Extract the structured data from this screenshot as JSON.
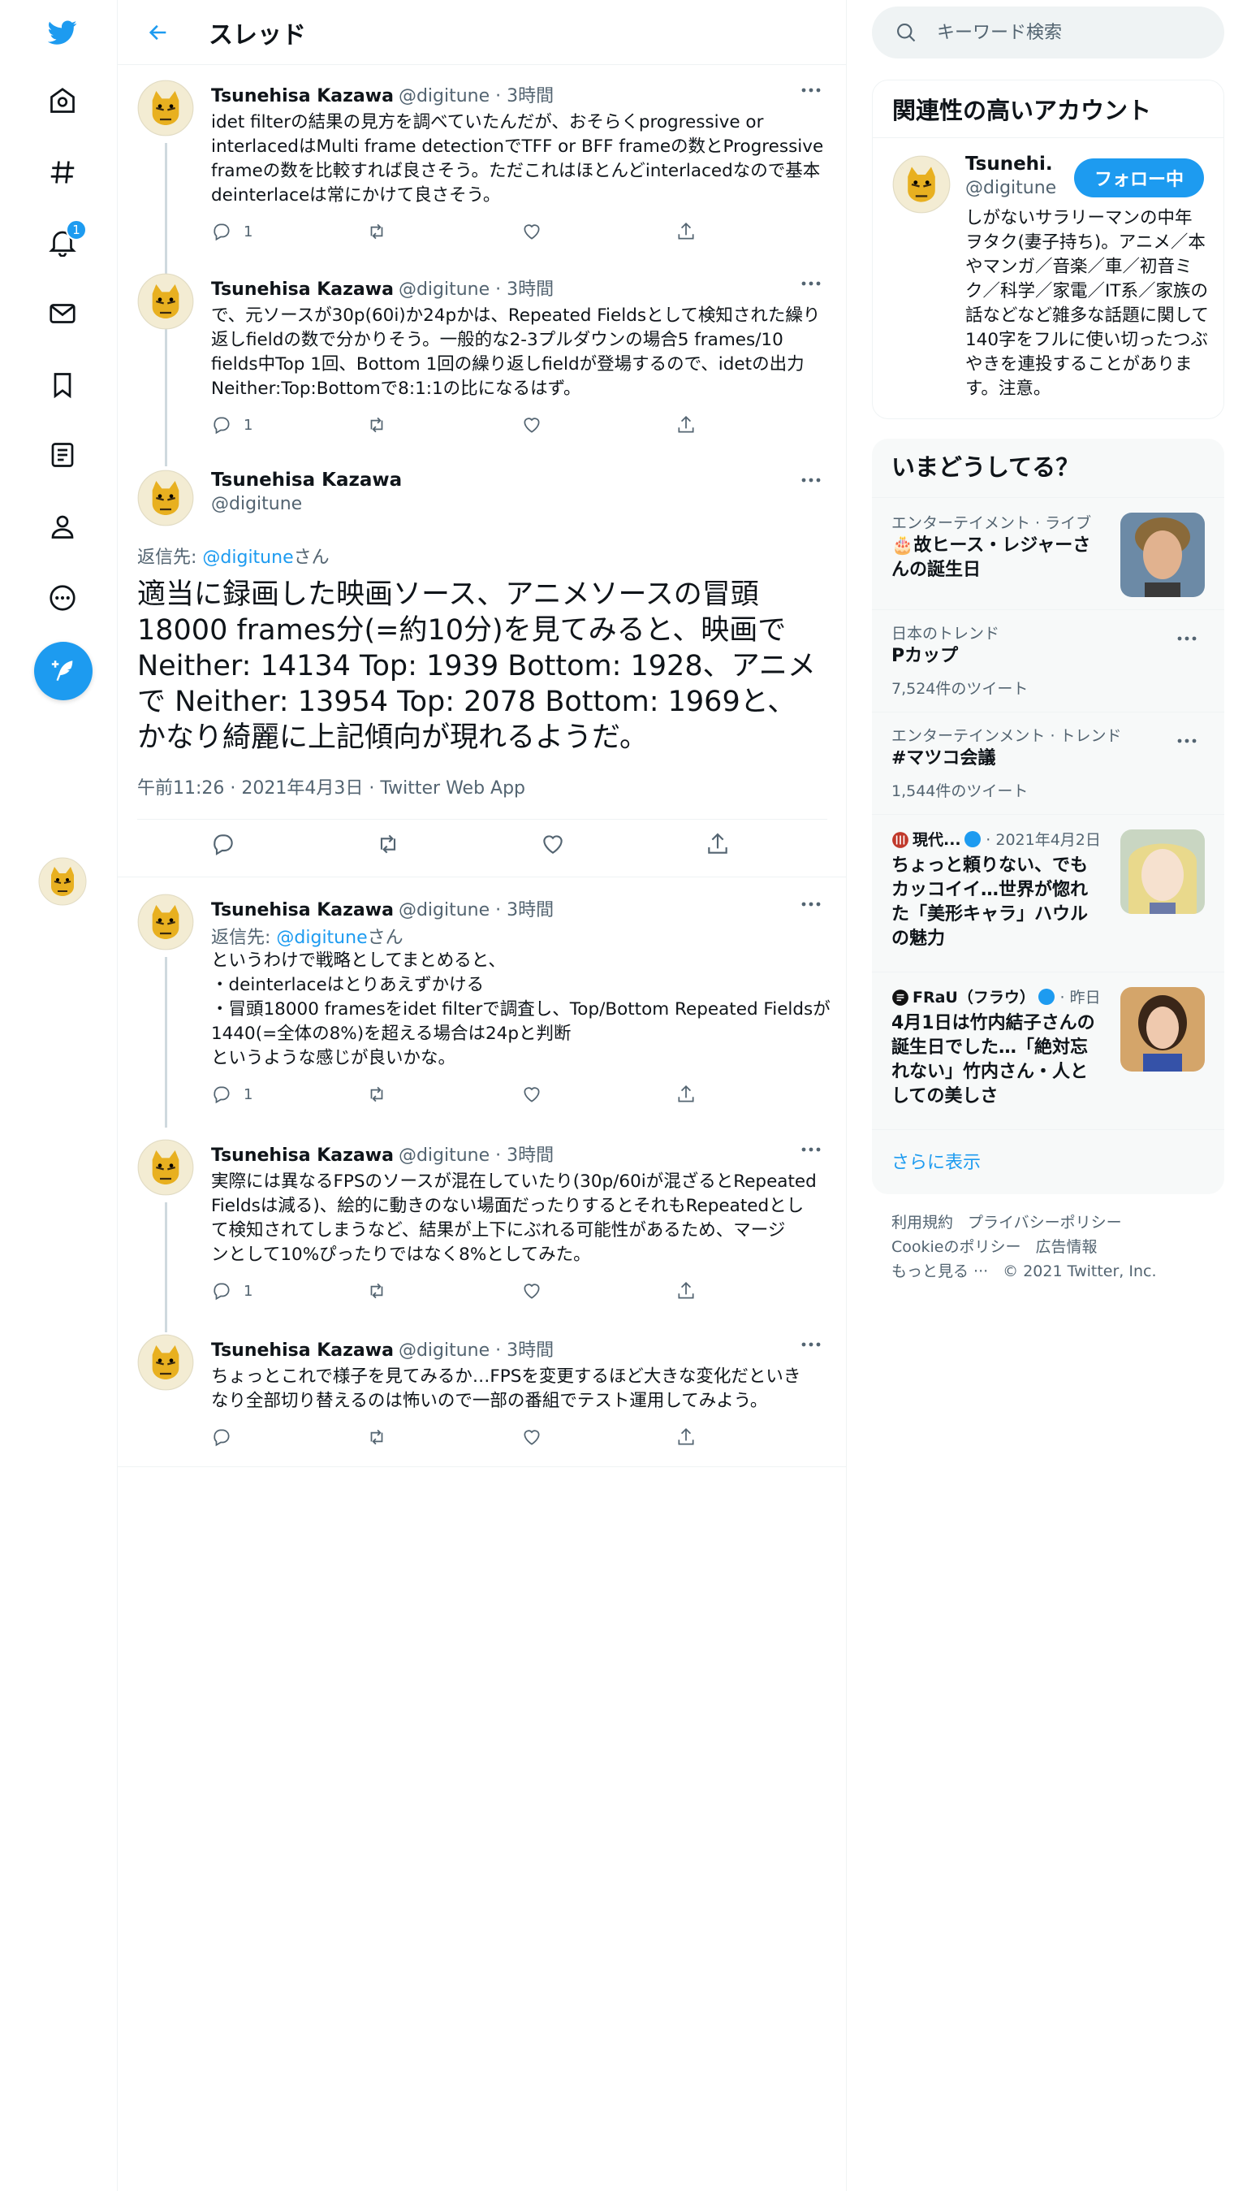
{
  "header": {
    "title": "スレッド"
  },
  "nav": {
    "notification_count": "1"
  },
  "colors": {
    "accent": "#1d9bf0",
    "muted": "#536471",
    "text": "#0f1419"
  },
  "tweets": [
    {
      "name": "Tsunehisa Kazawa",
      "meta": "@digitune · 3時間",
      "text": "idet filterの結果の見方を調べていたんだが、おそらくprogressive or\ninterlacedはMulti frame detectionでTFF or BFF frameの数とProgressive\nframeの数を比較すれば良さそう。ただこれはほとんどinterlacedなので基本\ndeinterlaceは常にかけて良さそう。",
      "reply_count": "1"
    },
    {
      "name": "Tsunehisa Kazawa",
      "meta": "@digitune · 3時間",
      "text": "で、元ソースが30p(60i)か24pかは、Repeated Fieldsとして検知された繰り\n返しfieldの数で分かりそう。一般的な2-3プルダウンの場合5 frames/10\nfields中Top 1回、Bottom 1回の繰り返しfieldが登場するので、idetの出力\nNeither:Top:Bottomで8:1:1の比になるはず。",
      "reply_count": "1"
    }
  ],
  "focal": {
    "name": "Tsunehisa Kazawa",
    "handle": "@digitune",
    "reply_prefix": "返信先: ",
    "reply_to": "@digitune",
    "reply_suffix": "さん",
    "text": "適当に録画した映画ソース、アニメソースの冒頭18000 frames分(=約10分)を見てみると、映画で Neither: 14134 Top:  1939 Bottom:  1928、アニメで Neither: 13954 Top:  2078 Bottom:  1969と、かなり綺麗に上記傾向が現れるようだ。",
    "timestamp": "午前11:26 · 2021年4月3日 · Twitter Web App"
  },
  "replies": [
    {
      "name": "Tsunehisa Kazawa",
      "meta": "@digitune · 3時間",
      "reply_prefix": "返信先: ",
      "reply_to": "@digitune",
      "reply_suffix": "さん",
      "text": "というわけで戦略としてまとめると、\n・deinterlaceはとりあえずかける\n・冒頭18000 framesをidet filterで調査し、Top/Bottom Repeated Fieldsが\n1440(=全体の8%)を超える場合は24pと判断\nというような感じが良いかな。",
      "reply_count": "1"
    },
    {
      "name": "Tsunehisa Kazawa",
      "meta": "@digitune · 3時間",
      "text": "実際には異なるFPSのソースが混在していたり(30p/60iが混ざるとRepeated\nFieldsは減る)、絵的に動きのない場面だったりするとそれもRepeatedとし\nて検知されてしまうなど、結果が上下にぶれる可能性があるため、マージ\nンとして10%ぴったりではなく8%としてみた。",
      "reply_count": "1"
    },
    {
      "name": "Tsunehisa Kazawa",
      "meta": "@digitune · 3時間",
      "text": "ちょっとこれで様子を見てみるか…FPSを変更するほど大きな変化だといき\nなり全部切り替えるのは怖いので一部の番組でテスト運用してみよう。",
      "reply_count": ""
    }
  ],
  "search": {
    "placeholder": "キーワード検索"
  },
  "related": {
    "title": "関連性の高いアカウント",
    "name": "Tsunehi...",
    "handle": "@digitune",
    "follow_label": "フォロー中",
    "bio": "しがないサラリーマンの中年ヲタク(妻子持ち)。アニメ／本やマンガ／音楽／車／初音ミク／科学／家電／IT系／家族の話などなど雑多な話題に関して140字をフルに使い切ったつぶやきを連投することがあります。注意。"
  },
  "trends": {
    "title": "いまどうしてる？",
    "items": [
      {
        "meta": "エンターテイメント · ライブ",
        "title": "🎂故ヒース・レジャーさんの誕生日",
        "count": ""
      },
      {
        "meta": "日本のトレンド",
        "title": "Pカップ",
        "count": "7,524件のツイート"
      },
      {
        "meta": "エンターテインメント · トレンド",
        "title": "#マツコ会議",
        "count": "1,544件のツイート"
      },
      {
        "meta_source": "現代...",
        "meta_time": "· 2021年4月2日",
        "title": "ちょっと頼りない、でもカッコイイ…世界が惚れた「美形キャラ」ハウルの魅力"
      },
      {
        "meta_source": "FRaU（フラウ）",
        "meta_time": "· 昨日",
        "title": "4月1日は竹内結子さんの誕生日でした…「絶対忘れない」竹内さん・人としての美しさ"
      }
    ],
    "show_more": "さらに表示"
  },
  "footer": {
    "links": [
      "利用規約",
      "プライバシーポリシー",
      "Cookieのポリシー",
      "広告情報",
      "もっと見る ···"
    ],
    "copyright": "© 2021 Twitter, Inc."
  }
}
